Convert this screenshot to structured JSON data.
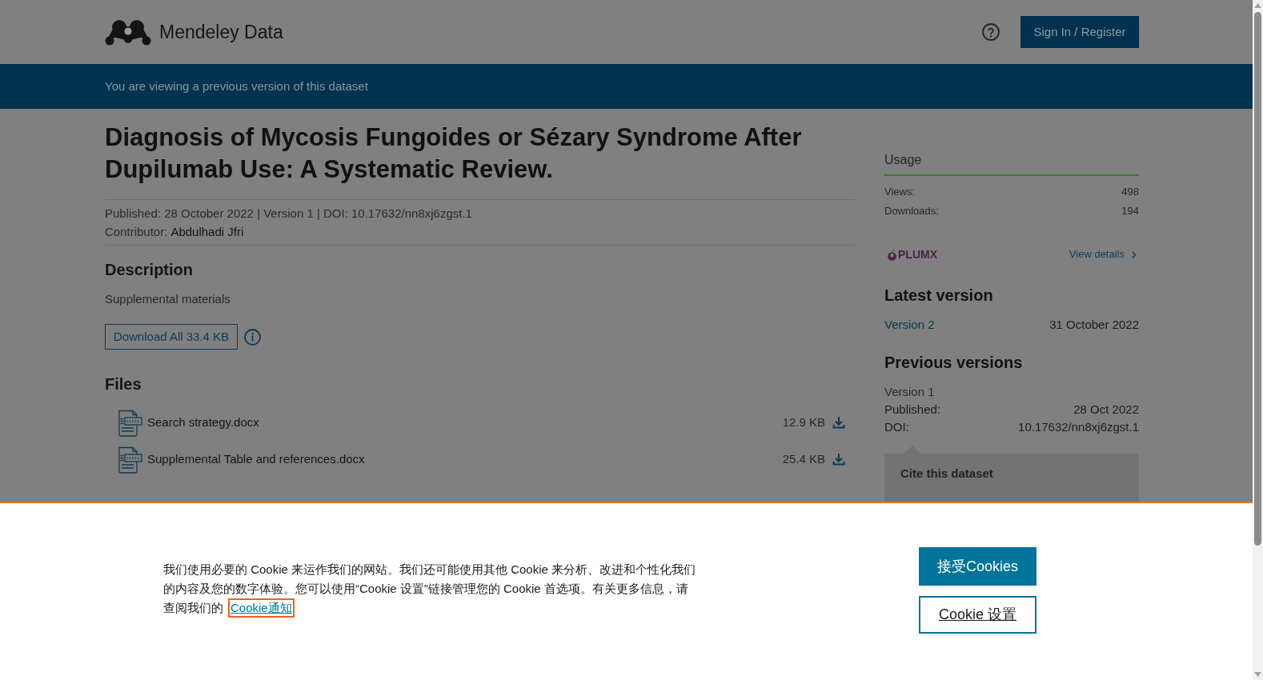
{
  "header": {
    "logo_text": "Mendeley Data",
    "sign_in": "Sign In / Register"
  },
  "notice_bar": {
    "text": "You are viewing a previous version of this dataset"
  },
  "dataset": {
    "title": "Diagnosis of Mycosis Fungoides or Sézary Syndrome After Dupilumab Use: A Systematic Review.",
    "meta": "Published: 28 October 2022 | Version 1 | DOI: 10.17632/nn8xj6zgst.1",
    "contributor_label": "Contributor:",
    "contributor": "Abdulhadi Jfri"
  },
  "description": {
    "heading": "Description",
    "text": "Supplemental materials",
    "download_all": "Download All 33.4 KB"
  },
  "files": {
    "heading": "Files",
    "items": [
      {
        "name": "Search strategy.docx",
        "size": "12.9 KB"
      },
      {
        "name": "Supplemental Table and references.docx",
        "size": "25.4 KB"
      }
    ]
  },
  "sidebar": {
    "usage": {
      "heading": "Usage",
      "stats": [
        {
          "label": "Views:",
          "value": "498"
        },
        {
          "label": "Downloads:",
          "value": "194"
        }
      ],
      "plumx_logo": "PLUMX",
      "plumx_link": "View details"
    },
    "latest_version": {
      "heading": "Latest version",
      "version": "Version 2",
      "date": "31 October 2022"
    },
    "previous_versions": {
      "heading": "Previous versions",
      "version": "Version 1",
      "rows": [
        {
          "label": "Published:",
          "value": "28 Oct 2022"
        },
        {
          "label": "DOI:",
          "value": "10.17632/nn8xj6zgst.1"
        }
      ]
    },
    "cite": {
      "heading": "Cite this dataset"
    }
  },
  "cookie_banner": {
    "text": "我们使用必要的 Cookie 来运作我们的网站。我们还可能使用其他 Cookie 来分析、改进和个性化我们的内容及您的数字体验。您可以使用“Cookie 设置”链接管理您的 Cookie 首选项。有关更多信息，请查阅我们的",
    "link": "Cookie通知",
    "link_focused": true,
    "accept": "接受Cookies",
    "settings": "Cookie 设置"
  }
}
